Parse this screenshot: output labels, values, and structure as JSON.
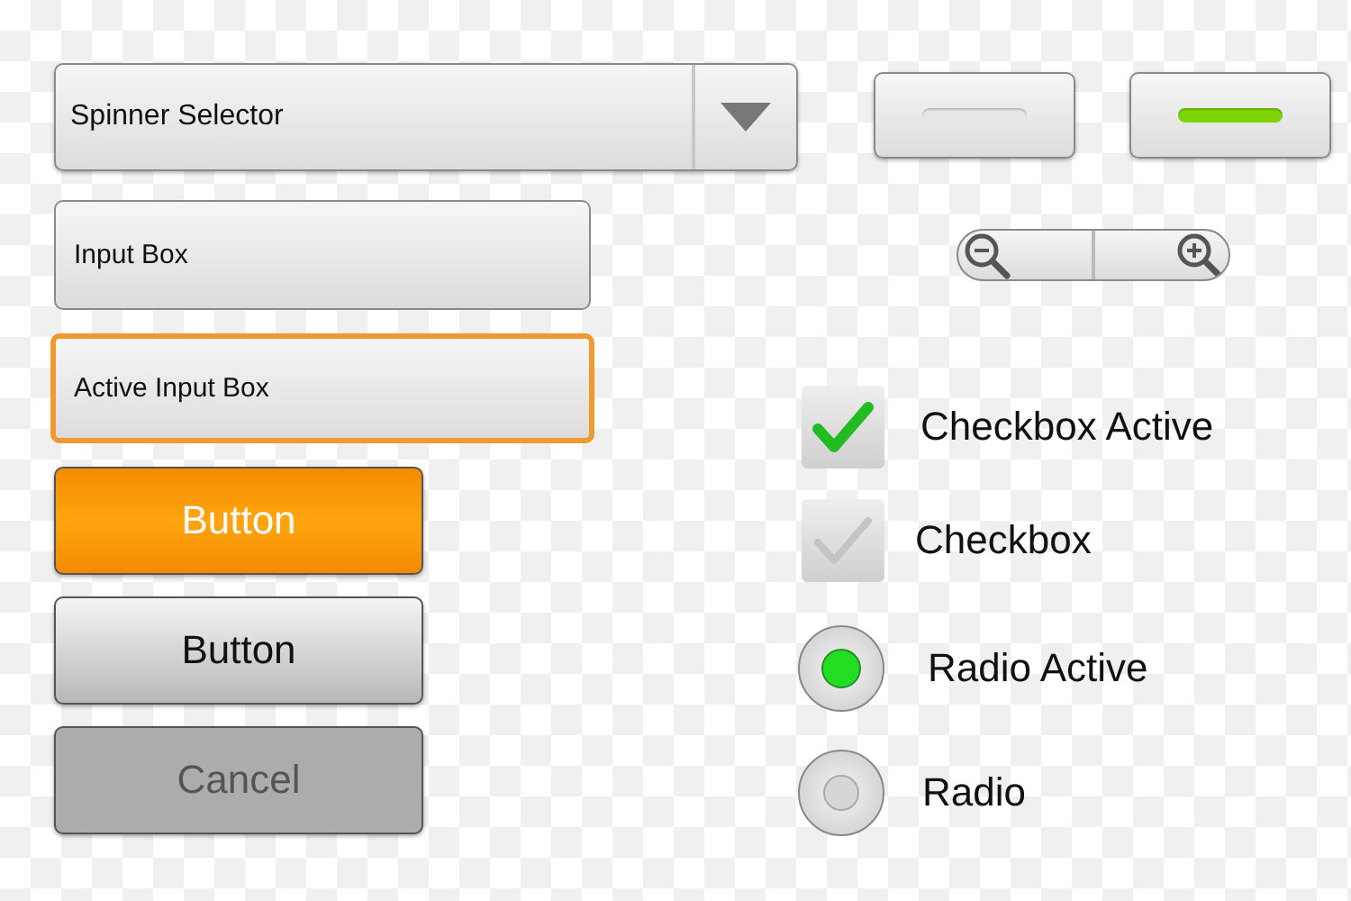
{
  "spinner": {
    "label": "Spinner Selector"
  },
  "inputs": [
    {
      "value": "Input Box",
      "active": false
    },
    {
      "value": "Active Input Box",
      "active": true
    }
  ],
  "buttons": [
    {
      "label": "Button",
      "kind": "primary"
    },
    {
      "label": "Button",
      "kind": "default"
    },
    {
      "label": "Cancel",
      "kind": "disabled"
    }
  ],
  "toggles": [
    {
      "on": false
    },
    {
      "on": true
    }
  ],
  "checkboxes": [
    {
      "label": "Checkbox Active",
      "checked": true
    },
    {
      "label": "Checkbox",
      "checked": false
    }
  ],
  "radios": [
    {
      "label": "Radio Active",
      "selected": true
    },
    {
      "label": "Radio",
      "selected": false
    }
  ]
}
